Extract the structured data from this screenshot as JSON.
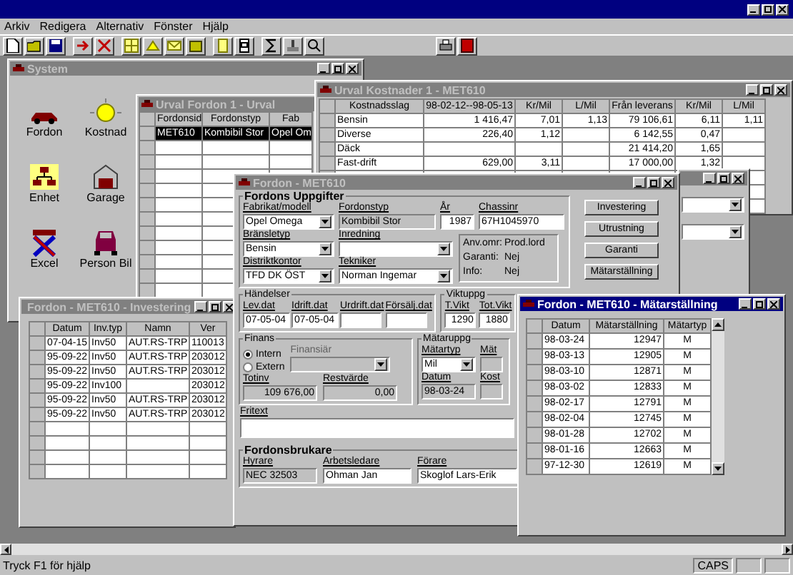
{
  "menu_bar": [
    "Arkiv",
    "Redigera",
    "Alternativ",
    "Fönster",
    "Hjälp"
  ],
  "system": {
    "title": "System",
    "active": false,
    "icons": [
      {
        "label": "Fordon",
        "kind": "car"
      },
      {
        "label": "Kostnad",
        "kind": "lamp"
      },
      {
        "label": "Enhet",
        "kind": "org"
      },
      {
        "label": "Garage",
        "kind": "garage"
      },
      {
        "label": "Excel",
        "kind": "excel"
      },
      {
        "label": "Person Bil",
        "kind": "personcar"
      }
    ]
  },
  "urval_fordon": {
    "title": "Urval Fordon 1 - Urval",
    "active": false,
    "columns": [
      "Fordonsid",
      "Fordonstyp",
      "Fab"
    ],
    "rows": [
      {
        "cells": [
          "MET610",
          "Kombibil Stor",
          "Opel Om"
        ],
        "selected": true
      }
    ]
  },
  "urval_kostnader": {
    "title": "Urval Kostnader 1 - MET610",
    "active": false,
    "columns": [
      "Kostnadsslag",
      "98-02-12--98-05-13",
      "Kr/Mil",
      "L/Mil",
      "Från leverans",
      "Kr/Mil",
      "L/Mil"
    ],
    "rows": [
      [
        "Bensin",
        "1 416,47",
        "7,01",
        "1,13",
        "79 106,61",
        "6,11",
        "1,11"
      ],
      [
        "Diverse",
        "226,40",
        "1,12",
        null,
        "6 142,55",
        "0,47",
        null
      ],
      [
        "Däck",
        null,
        null,
        null,
        "21 414,20",
        "1,65",
        null
      ],
      [
        "Fast-drift",
        "629,00",
        "3,11",
        null,
        "17 000,00",
        "1,32",
        null
      ]
    ]
  },
  "behind_window": {
    "active": false
  },
  "fordon": {
    "title": "Fordon - MET610",
    "active": false,
    "section": "Fordons Uppgifter",
    "row1": [
      {
        "label": "Fabrikat/modell",
        "value": "Opel Omega",
        "kind": "combo"
      },
      {
        "label": "Fordonstyp",
        "value": "Kombibil Stor",
        "kind": "readonly"
      },
      {
        "label": "År",
        "value": "1987",
        "kind": "number"
      },
      {
        "label": "Chassinr",
        "value": "67H1045970",
        "kind": "text"
      }
    ],
    "row2": [
      {
        "label": "Bränsletyp",
        "value": "Bensin",
        "kind": "combo"
      },
      {
        "label": "Inredning",
        "kind": "combo"
      }
    ],
    "row3": [
      {
        "label": "Distriktkontor",
        "value": "TFD DK ÖST",
        "kind": "combo"
      },
      {
        "label": "Tekniker",
        "value": "Norman Ingemar",
        "kind": "combo"
      }
    ],
    "info": [
      {
        "label": "Anv.omr:",
        "value": "Prod.lord"
      },
      {
        "label": "Garanti:",
        "value": "Nej"
      },
      {
        "label": "Info:",
        "value": "Nej"
      }
    ],
    "buttons": [
      "Investering",
      "Utrustning",
      "Garanti",
      "Mätarställning"
    ],
    "events": {
      "title": "Händelser",
      "fields": [
        {
          "label": "Lev.dat",
          "value": "07-05-04",
          "kind": "text"
        },
        {
          "label": "Idrift.dat",
          "value": "07-05-04",
          "kind": "text"
        },
        {
          "label": "Urdrift.dat",
          "kind": "text"
        },
        {
          "label": "Försälj.dat",
          "kind": "text"
        }
      ]
    },
    "weights": {
      "title": "Viktuppg",
      "fields": [
        {
          "label": "T.Vikt",
          "value": "1290",
          "kind": "number"
        },
        {
          "label": "Tot.Vikt",
          "value": "1880",
          "kind": "number"
        }
      ]
    },
    "finance": {
      "title": "Finans",
      "options": [
        {
          "label": "Intern",
          "selected": true
        },
        {
          "label": "Extern",
          "selected": false
        }
      ],
      "financier": {
        "label": "Finansiär",
        "disabled": true
      },
      "fields": [
        {
          "label": "Totinv",
          "value": "109 676,00",
          "kind": "rreadonly"
        },
        {
          "label": "Restvärde",
          "value": "0,00",
          "kind": "rreadonly"
        }
      ]
    },
    "meter": {
      "title": "Mätaruppg",
      "fields": [
        {
          "label": "Mätartyp",
          "value": "Mil",
          "kind": "combo"
        },
        {
          "label": "Mät",
          "kind": "readonly"
        },
        {
          "label": "Datum",
          "value": "98-03-24",
          "kind": "readonly"
        },
        {
          "label": "Kost",
          "kind": "readonly"
        }
      ]
    },
    "free_text": {
      "label": "Fritext"
    },
    "users": {
      "title": "Fordonsbrukare",
      "fields": [
        {
          "label": "Hyrare",
          "value": "NEC 32503",
          "kind": "readonly"
        },
        {
          "label": "Arbetsledare",
          "value": "Ohman Jan",
          "kind": "text"
        },
        {
          "label": "Förare",
          "value": "Skoglof Lars-Erik",
          "kind": "text"
        }
      ]
    }
  },
  "investering": {
    "title": "Fordon - MET610 - Investering",
    "active": false,
    "columns": [
      "Datum",
      "Inv.typ",
      "Namn",
      "Ver"
    ],
    "rows": [
      [
        "07-04-15",
        "Inv50",
        "AUT.RS-TRP",
        "110013"
      ],
      [
        "95-09-22",
        "Inv50",
        "AUT.RS-TRP",
        "203012"
      ],
      [
        "95-09-22",
        "Inv50",
        "AUT.RS-TRP",
        "203012"
      ],
      [
        "95-09-22",
        "Inv100",
        null,
        "203012"
      ],
      [
        "95-09-22",
        "Inv50",
        "AUT.RS-TRP",
        "203012"
      ],
      [
        "95-09-22",
        "Inv50",
        "AUT.RS-TRP",
        "203012"
      ]
    ]
  },
  "matarstallning": {
    "title": "Fordon - MET610 - Mätarställning",
    "active": true,
    "columns": [
      "Datum",
      "Mätarställning",
      "Mätartyp"
    ],
    "rows": [
      [
        "98-03-24",
        "12947",
        "M"
      ],
      [
        "98-03-13",
        "12905",
        "M"
      ],
      [
        "98-03-10",
        "12871",
        "M"
      ],
      [
        "98-03-02",
        "12833",
        "M"
      ],
      [
        "98-02-17",
        "12791",
        "M"
      ],
      [
        "98-02-04",
        "12745",
        "M"
      ],
      [
        "98-01-28",
        "12702",
        "M"
      ],
      [
        "98-01-16",
        "12663",
        "M"
      ],
      [
        "97-12-30",
        "12619",
        "M"
      ]
    ]
  },
  "status_bar": {
    "help": "Tryck F1 för hjälp",
    "indicators": [
      "CAPS"
    ]
  }
}
